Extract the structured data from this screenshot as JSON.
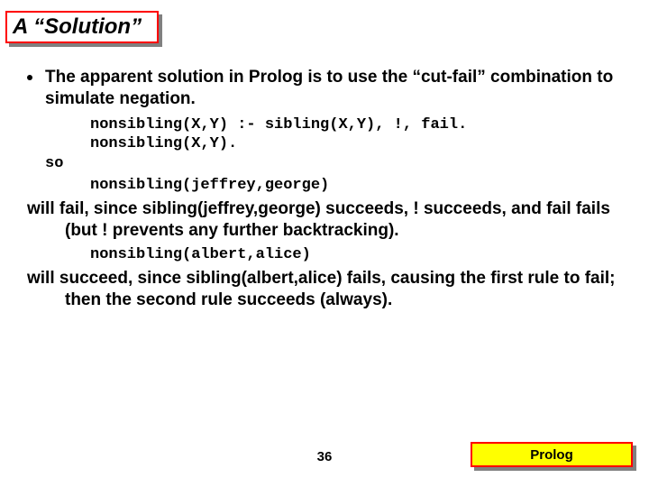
{
  "title": "A “Solution”",
  "bullet1": "The apparent solution in Prolog is to use the “cut-fail” combination to simulate negation.",
  "code1": "nonsibling(X,Y) :- sibling(X,Y), !, fail.\nnonsibling(X,Y).",
  "so": "so",
  "code2": "nonsibling(jeffrey,george)",
  "para1": "will fail, since sibling(jeffrey,george) succeeds, ! succeeds, and fail fails (but ! prevents any further backtracking).",
  "code3": "nonsibling(albert,alice)",
  "para2": "will succeed, since sibling(albert,alice) fails, causing the first rule to fail; then the second rule succeeds (always).",
  "pageNumber": "36",
  "footerLabel": "Prolog"
}
